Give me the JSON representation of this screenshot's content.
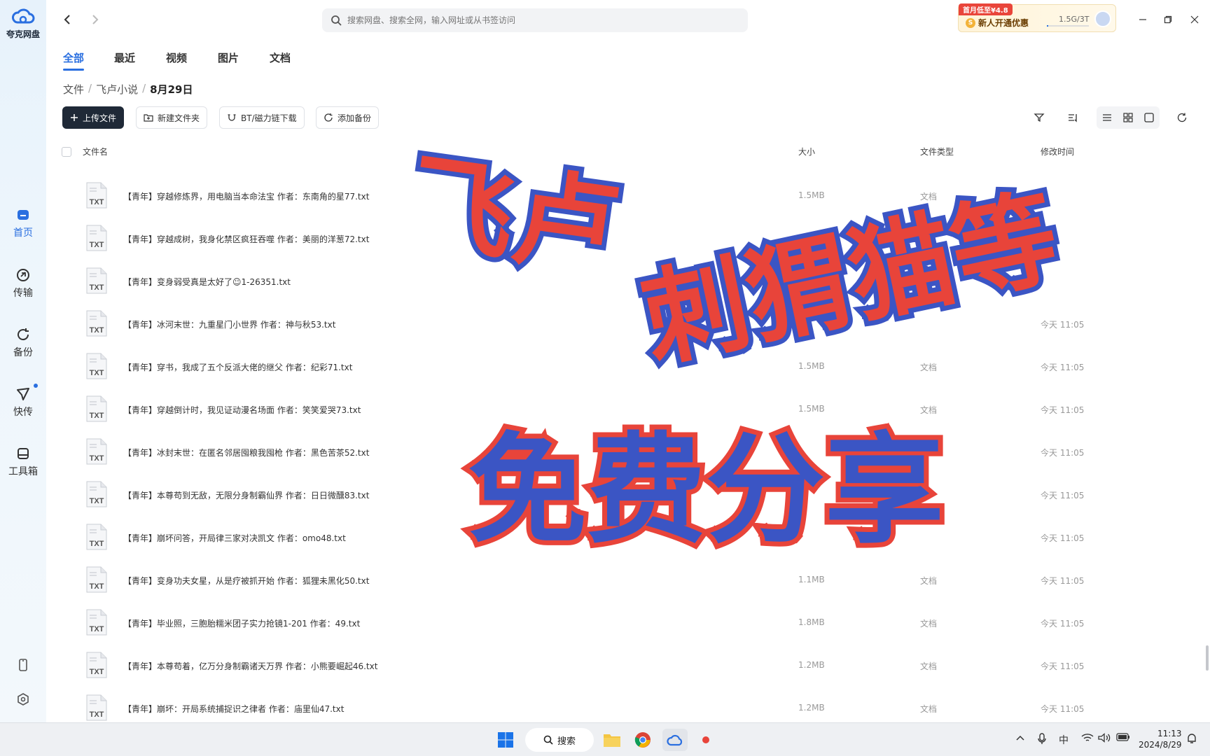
{
  "app": {
    "name": "夸克网盘"
  },
  "sidebar": {
    "items": [
      {
        "label": "首页",
        "icon": "home-icon"
      },
      {
        "label": "传输",
        "icon": "transfer-icon"
      },
      {
        "label": "备份",
        "icon": "backup-icon"
      },
      {
        "label": "快传",
        "icon": "quick-send-icon"
      },
      {
        "label": "工具箱",
        "icon": "toolbox-icon"
      }
    ]
  },
  "search": {
    "placeholder": "搜索网盘、搜索全网，输入网址或从书签访问"
  },
  "promo": {
    "tag": "首月低至¥4.8",
    "label": "新人开通优惠",
    "storage": "1.5G/3T",
    "storage_used_fraction": 0.0005
  },
  "tabs": [
    "全部",
    "最近",
    "视频",
    "图片",
    "文档"
  ],
  "breadcrumb": [
    "文件",
    "飞卢小说",
    "8月29日"
  ],
  "toolbar": {
    "upload": "上传文件",
    "new_folder": "新建文件夹",
    "bt_download": "BT/磁力链下载",
    "add_backup": "添加备份"
  },
  "table": {
    "headers": {
      "name": "文件名",
      "size": "大小",
      "type": "文件类型",
      "mtime": "修改时间"
    },
    "icon_label": "TXT",
    "rows": [
      {
        "name": "【青年】穿越修炼界，用电脑当本命法宝 作者：东南角的星77.txt",
        "size": "1.5MB",
        "type": "文档",
        "time": ""
      },
      {
        "name": "【青年】穿越成树，我身化禁区疯狂吞噬 作者：美丽的洋葱72.txt",
        "size": "",
        "type": "",
        "time": ""
      },
      {
        "name": "【青年】变身弱受真是太好了☺1-26351.txt",
        "size": "",
        "type": "",
        "time": ""
      },
      {
        "name": "【青年】冰河末世：九重星门小世界 作者：神与秋53.txt",
        "size": "",
        "type": "",
        "time": "今天 11:05"
      },
      {
        "name": "【青年】穿书，我成了五个反派大佬的继父 作者：纪彩71.txt",
        "size": "1.5MB",
        "type": "文档",
        "time": "今天 11:05"
      },
      {
        "name": "【青年】穿越倒计时，我见证动漫名场面 作者：笑笑爱哭73.txt",
        "size": "1.5MB",
        "type": "文档",
        "time": "今天 11:05"
      },
      {
        "name": "【青年】冰封末世：在匿名邻居囤粮我囤枪 作者：黑色苦茶52.txt",
        "size": "",
        "type": "",
        "time": "今天 11:05"
      },
      {
        "name": "【青年】本尊苟到无敌，无限分身制霸仙界 作者：日日微醺83.txt",
        "size": "",
        "type": "",
        "time": "今天 11:05"
      },
      {
        "name": "【青年】崩坏问答，开局律三家对决凯文 作者：omo48.txt",
        "size": "",
        "type": "",
        "time": "今天 11:05"
      },
      {
        "name": "【青年】变身功夫女星，从是疗被抓开始 作者：狐狸未黑化50.txt",
        "size": "1.1MB",
        "type": "文档",
        "time": "今天 11:05"
      },
      {
        "name": "【青年】毕业照，三胞胎糯米团子实力抢镜1-201 作者：49.txt",
        "size": "1.8MB",
        "type": "文档",
        "time": "今天 11:05"
      },
      {
        "name": "【青年】本尊苟着，亿万分身制霸诸天万界 作者：小熊要崛起46.txt",
        "size": "1.2MB",
        "type": "文档",
        "time": "今天 11:05"
      },
      {
        "name": "【青年】崩坏：开局系统捕捉识之律者 作者：庙里仙47.txt",
        "size": "1.2MB",
        "type": "文档",
        "time": "今天 11:05"
      }
    ]
  },
  "overlay": {
    "line1": "飞卢",
    "line2": "刺猬猫等",
    "line3": "免费分享",
    "colors": {
      "red": "#e8443a",
      "blue": "#3b55c4"
    }
  },
  "taskbar": {
    "search_label": "搜索",
    "ime": "中",
    "time": "11:13",
    "date": "2024/8/29"
  },
  "colors": {
    "accent": "#2a6fe0",
    "primary_button": "#1f2937"
  }
}
